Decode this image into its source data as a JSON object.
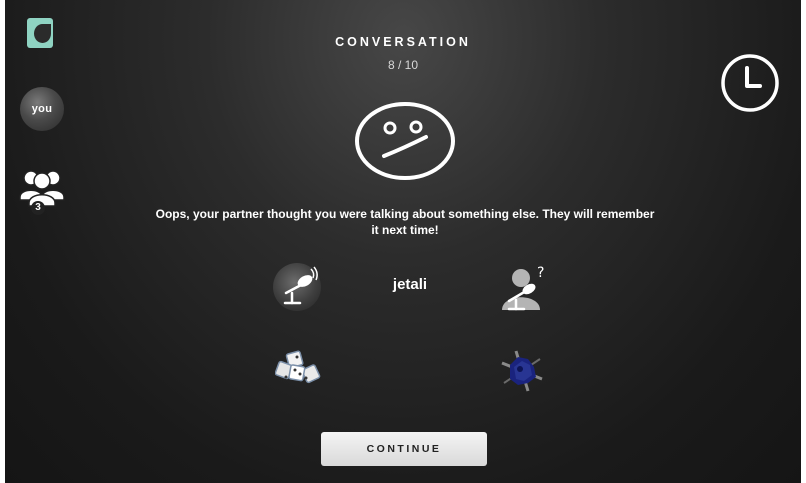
{
  "header": {
    "title": "CONVERSATION",
    "progress": "8 / 10"
  },
  "sidebar": {
    "avatar_label": "you",
    "group_count": "3"
  },
  "result": {
    "message": "Oops, your partner thought you were talking about something else. They will remember it next time!",
    "word": "jetali"
  },
  "footer": {
    "continue_label": "CONTINUE"
  },
  "icons": {
    "logo": "app-logo-icon",
    "group": "group-icon",
    "timer": "clock-icon",
    "feedback": "confused-face-icon",
    "speaker": "microphone-icon",
    "listener": "listener-question-icon"
  },
  "colors": {
    "background": "#1e1e1e",
    "logo_accent": "#8fd3c2",
    "partner_b": "#1a237e"
  }
}
